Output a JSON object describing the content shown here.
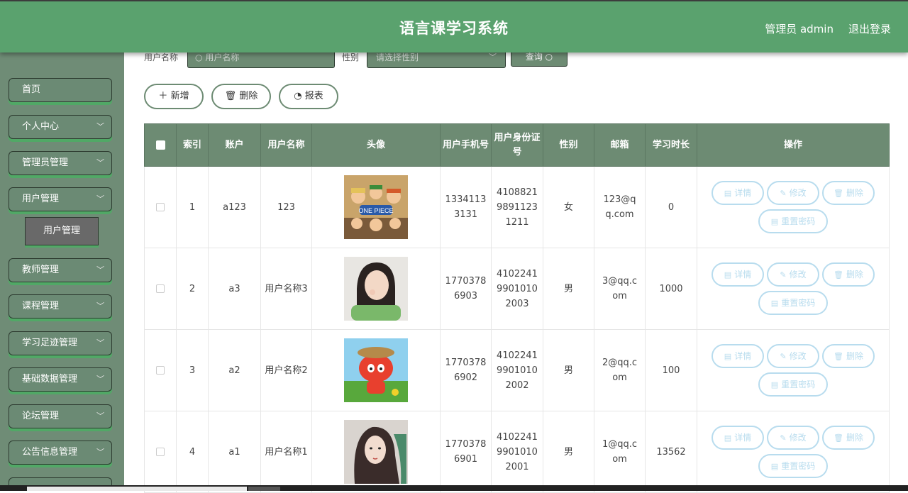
{
  "header": {
    "title": "语言课学习系统",
    "user": "管理员 admin",
    "logout": "退出登录"
  },
  "sidebar": {
    "items": [
      {
        "label": "首页",
        "has_arrow": false
      },
      {
        "label": "个人中心",
        "has_arrow": true
      },
      {
        "label": "管理员管理",
        "has_arrow": true
      },
      {
        "label": "用户管理",
        "has_arrow": true
      },
      {
        "label": "教师管理",
        "has_arrow": true
      },
      {
        "label": "课程管理",
        "has_arrow": true
      },
      {
        "label": "学习足迹管理",
        "has_arrow": true
      },
      {
        "label": "基础数据管理",
        "has_arrow": true
      },
      {
        "label": "论坛管理",
        "has_arrow": true
      },
      {
        "label": "公告信息管理",
        "has_arrow": true
      }
    ],
    "sub_item": "用户管理"
  },
  "search": {
    "username_label": "用户名称",
    "username_placeholder": "用户名称",
    "gender_label": "性别",
    "gender_placeholder": "请选择性别",
    "query_button": "查询"
  },
  "actions": {
    "add": "新增",
    "delete": "删除",
    "report": "报表"
  },
  "table": {
    "headers": [
      "",
      "索引",
      "账户",
      "用户名称",
      "头像",
      "用户手机号",
      "用户身份证号",
      "性别",
      "邮箱",
      "学习时长",
      "操作"
    ],
    "rows": [
      {
        "index": "1",
        "account": "a123",
        "name": "123",
        "avatar": "onepiece-avatar",
        "phone": "13341133131",
        "idcard": "410882198911231211",
        "gender": "女",
        "email": "123@qq.com",
        "duration": "0"
      },
      {
        "index": "2",
        "account": "a3",
        "name": "用户名称3",
        "avatar": "girl-photo-avatar",
        "phone": "17703786903",
        "idcard": "410224199010102003",
        "gender": "男",
        "email": "3@qq.com",
        "duration": "1000"
      },
      {
        "index": "3",
        "account": "a2",
        "name": "用户名称2",
        "avatar": "cartoon-fox-avatar",
        "phone": "17703786902",
        "idcard": "410224199010102002",
        "gender": "男",
        "email": "2@qq.com",
        "duration": "100"
      },
      {
        "index": "4",
        "account": "a1",
        "name": "用户名称1",
        "avatar": "painted-woman-avatar",
        "phone": "17703786901",
        "idcard": "410224199010102001",
        "gender": "男",
        "email": "1@qq.com",
        "duration": "13562"
      }
    ],
    "row_actions": {
      "detail": "详情",
      "edit": "修改",
      "delete": "删除",
      "reset": "重置密码"
    }
  },
  "colors": {
    "header_bg": "#5aa26e",
    "sidebar_bg": "#6f8c76",
    "table_header_bg": "#6d8b73",
    "op_button": "#b8dcee"
  }
}
